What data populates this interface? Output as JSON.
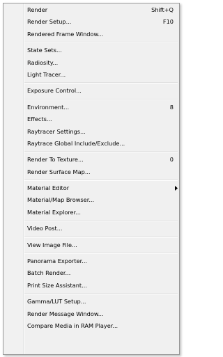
{
  "menu": {
    "groups": [
      [
        {
          "label": "Render",
          "shortcut": "Shift+Q"
        },
        {
          "label": "Render Setup...",
          "shortcut": "F10"
        },
        {
          "label": "Rendered Frame Window...",
          "shortcut": ""
        }
      ],
      [
        {
          "label": "State Sets...",
          "shortcut": ""
        },
        {
          "label": "Radiosity...",
          "shortcut": ""
        },
        {
          "label": "Light Tracer...",
          "shortcut": ""
        }
      ],
      [
        {
          "label": "Exposure Control...",
          "shortcut": ""
        }
      ],
      [
        {
          "label": "Environment...",
          "shortcut": "8"
        },
        {
          "label": "Effects...",
          "shortcut": ""
        },
        {
          "label": "Raytracer Settings...",
          "shortcut": ""
        },
        {
          "label": "Raytrace Global Include/Exclude...",
          "shortcut": ""
        }
      ],
      [
        {
          "label": "Render To Texture...",
          "shortcut": "0"
        },
        {
          "label": "Render Surface Map...",
          "shortcut": ""
        }
      ],
      [
        {
          "label": "Material Editor",
          "shortcut": "",
          "submenu": true
        },
        {
          "label": "Material/Map Browser...",
          "shortcut": ""
        },
        {
          "label": "Material Explorer...",
          "shortcut": ""
        }
      ],
      [
        {
          "label": "Video Post...",
          "shortcut": ""
        }
      ],
      [
        {
          "label": "View Image File...",
          "shortcut": ""
        }
      ],
      [
        {
          "label": "Panorama Exporter...",
          "shortcut": ""
        },
        {
          "label": "Batch Render...",
          "shortcut": ""
        },
        {
          "label": "Print Size Assistant...",
          "shortcut": ""
        }
      ],
      [
        {
          "label": "Gamma/LUT Setup...",
          "shortcut": ""
        },
        {
          "label": "Render Message Window...",
          "shortcut": ""
        },
        {
          "label": "Compare Media in RAM Player...",
          "shortcut": ""
        }
      ]
    ],
    "submenu_arrow_icon": "triangle-right-icon"
  }
}
